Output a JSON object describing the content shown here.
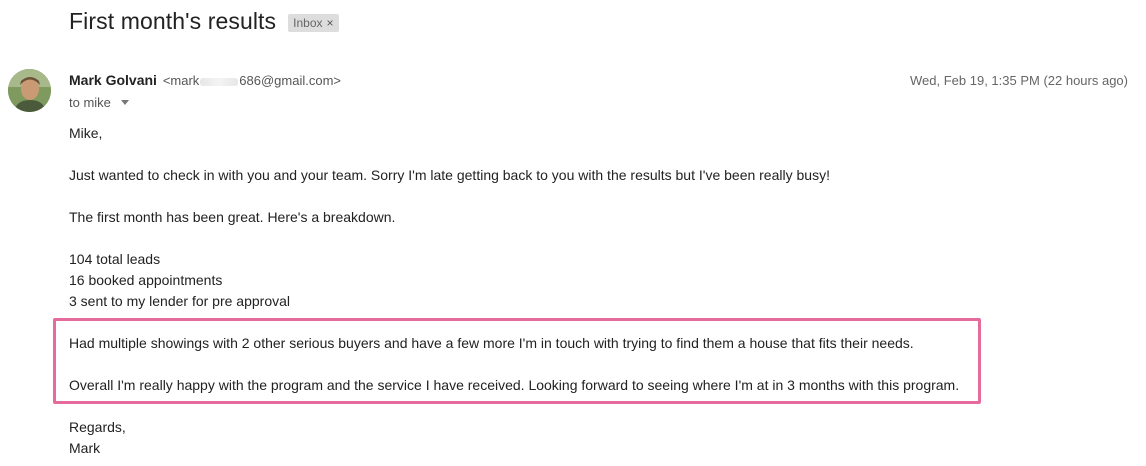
{
  "email": {
    "subject": "First month's results",
    "label": "Inbox",
    "label_close": "×",
    "sender_name": "Mark Golvani",
    "sender_email_prefix": "<mark",
    "sender_email_suffix": "686@gmail.com>",
    "date": "Wed, Feb 19, 1:35 PM (22 hours ago)",
    "to_text": "to mike"
  },
  "body": {
    "greeting": "Mike,",
    "line1": "Just wanted to check in with you and your team. Sorry I'm late getting back to you with the results but I've been really busy!",
    "line2": "The first month has been great. Here's a breakdown.",
    "stat1": "104 total leads",
    "stat2": "16 booked appointments",
    "stat3": "3 sent to my lender for pre approval",
    "highlight1": "Had multiple showings with 2 other serious buyers and have a few more I'm in touch with trying to find them a house that fits their needs.",
    "highlight2": "Overall I'm really happy with the program and the service I have received. Looking forward to seeing where I'm at in 3 months with this program.",
    "closing": "Regards,",
    "signature": "Mark"
  },
  "colors": {
    "highlight_border": "#e56b9c"
  }
}
